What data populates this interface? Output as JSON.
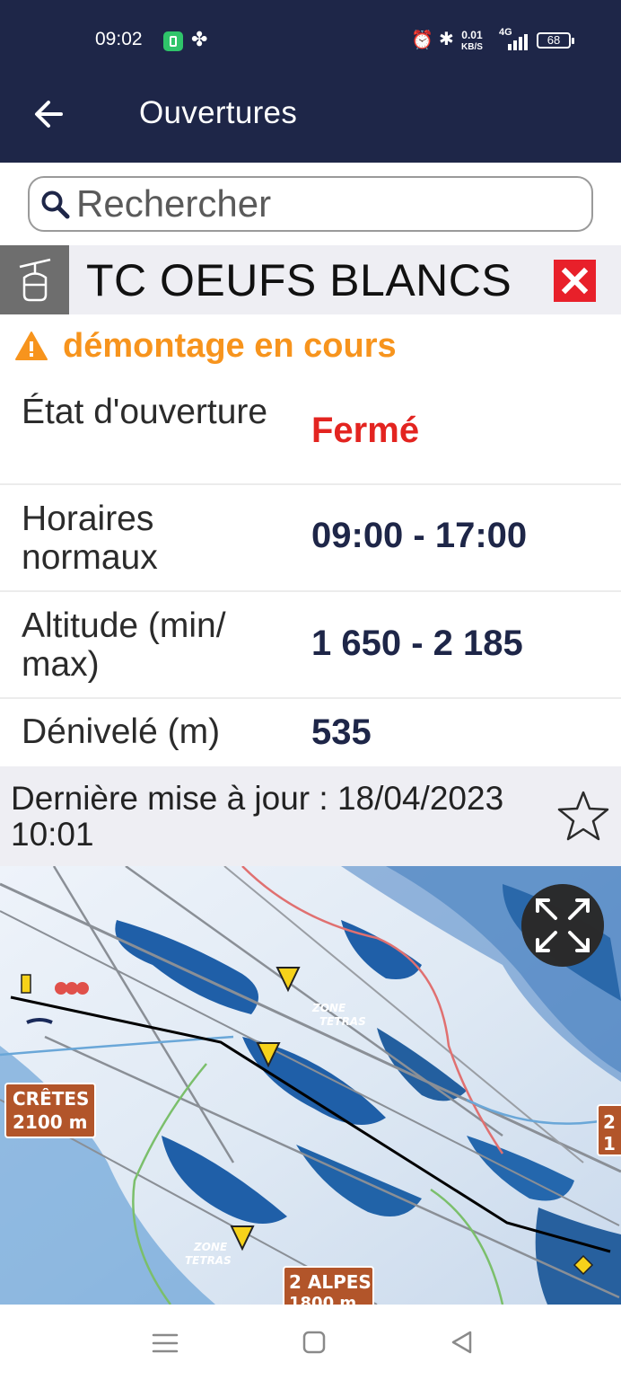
{
  "status_bar": {
    "time": "09:02",
    "network_speed_value": "0.01",
    "network_speed_unit": "KB/S",
    "network_type": "4G",
    "battery": "68"
  },
  "app_bar": {
    "title": "Ouvertures"
  },
  "search": {
    "placeholder": "Rechercher"
  },
  "lift": {
    "name": "TC OEUFS BLANCS",
    "warning": "démontage en cours",
    "rows": [
      {
        "label": "État d'ouverture",
        "value": "Fermé"
      },
      {
        "label": "Horaires normaux",
        "value": "09:00 - 17:00"
      },
      {
        "label": "Altitude (min/ max)",
        "value": "1 650 - 2 185"
      },
      {
        "label": "Dénivelé (m)",
        "value": "535"
      }
    ],
    "last_update": "Dernière mise à jour : 18/04/2023 10:01"
  },
  "map": {
    "labels": {
      "cretes_name": "CRÊTES",
      "cretes_alt": "2100 m",
      "alpes_name": "2 ALPES",
      "alpes_alt": "1800 m",
      "zone1": "ZONE",
      "zone1b": "TETRAS",
      "zone2": "ZONE",
      "zone2b": "TETRAS",
      "edge1": "2",
      "edge2": "1"
    }
  },
  "colors": {
    "app_bar": "#1e2648",
    "closed": "#e32420",
    "warning": "#f7941d",
    "value": "#1e2648",
    "close_button": "#e8202a"
  },
  "icons": {
    "back": "arrow-left-icon",
    "search": "search-icon",
    "lift": "gondola-icon",
    "close": "close-icon",
    "warning": "warning-triangle-icon",
    "favorite": "star-outline-icon",
    "expand": "expand-icon"
  }
}
